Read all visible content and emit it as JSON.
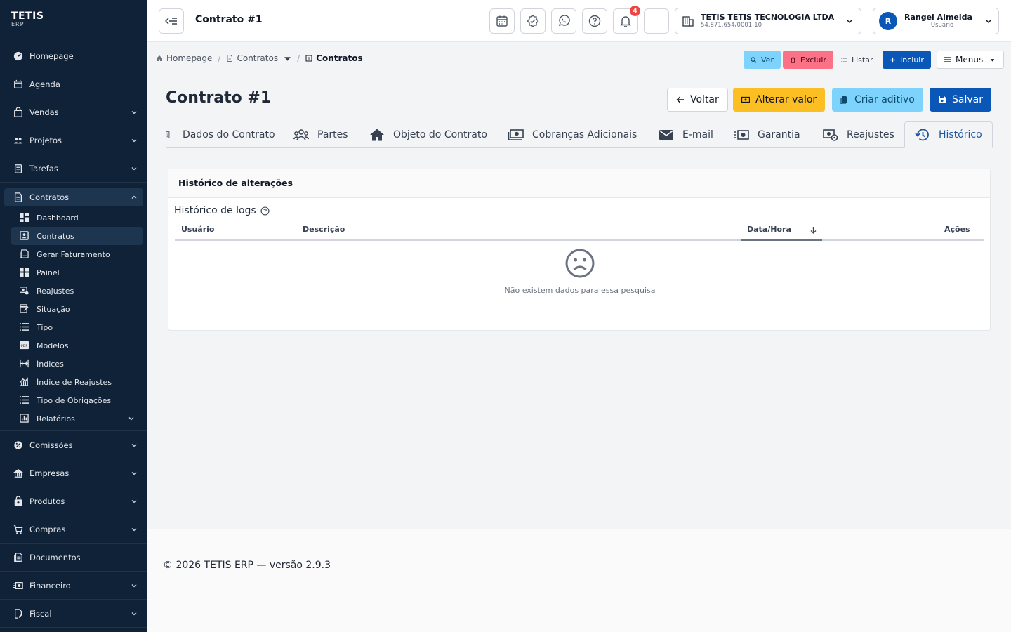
{
  "brand": {
    "name": "TETIS",
    "sub": "ERP"
  },
  "sidebar": {
    "items_top": [
      {
        "label": "Homepage",
        "icon": "dashboard-icon",
        "chev": false
      },
      {
        "label": "Agenda",
        "icon": "calendar-icon",
        "chev": false
      },
      {
        "label": "Vendas",
        "icon": "bag-icon",
        "chev": true
      },
      {
        "label": "Projetos",
        "icon": "people-icon",
        "chev": true
      },
      {
        "label": "Tarefas",
        "icon": "clipboard-icon",
        "chev": true
      }
    ],
    "open_item": {
      "label": "Contratos",
      "icon": "document-icon"
    },
    "sub_items": [
      {
        "label": "Dashboard",
        "icon": "dashboard-grid-icon"
      },
      {
        "label": "Contratos",
        "icon": "contract-icon",
        "active": true
      },
      {
        "label": "Gerar Faturamento",
        "icon": "invoice-icon"
      },
      {
        "label": "Painel",
        "icon": "panel-icon"
      },
      {
        "label": "Reajustes",
        "icon": "adjust-icon"
      },
      {
        "label": "Situação",
        "icon": "status-icon"
      },
      {
        "label": "Tipo",
        "icon": "list-icon"
      },
      {
        "label": "Modelos",
        "icon": "pdf-icon"
      },
      {
        "label": "Índices",
        "icon": "index-icon"
      },
      {
        "label": "Índice de Reajustes",
        "icon": "chart-icon"
      },
      {
        "label": "Tipo de Obrigações",
        "icon": "list-icon"
      },
      {
        "label": "Relatórios",
        "icon": "report-icon",
        "chev": true
      }
    ],
    "items_bottom": [
      {
        "label": "Comissões",
        "icon": "commission-icon",
        "chev": true
      },
      {
        "label": "Empresas",
        "icon": "building-icon",
        "chev": true
      },
      {
        "label": "Produtos",
        "icon": "box-icon",
        "chev": true
      },
      {
        "label": "Compras",
        "icon": "cart-icon",
        "chev": true
      },
      {
        "label": "Documentos",
        "icon": "documents-icon",
        "chev": false
      },
      {
        "label": "Financeiro",
        "icon": "money-icon",
        "chev": true
      },
      {
        "label": "Fiscal",
        "icon": "fiscal-icon",
        "chev": true
      }
    ]
  },
  "topbar": {
    "title": "Contrato #1",
    "notification_count": "4",
    "company_name": "TETIS TETIS TECNOLOGIA LTDA",
    "company_cnpj": "54.871.654/0001-10",
    "user_initial": "R",
    "user_name": "Rangel Almeida",
    "user_role": "Usuário"
  },
  "breadcrumb": {
    "home": "Homepage",
    "parent": "Contratos",
    "current": "Contratos"
  },
  "actions": {
    "ver": "Ver",
    "excluir": "Excluir",
    "listar": "Listar",
    "incluir": "Incluir",
    "menus": "Menus"
  },
  "page": {
    "title": "Contrato #1",
    "btn_voltar": "Voltar",
    "btn_alterar": "Alterar valor",
    "btn_aditivo": "Criar aditivo",
    "btn_salvar": "Salvar"
  },
  "tabs": [
    "Dados do Contrato",
    "Partes",
    "Objeto do Contrato",
    "Cobranças Adicionais",
    "E-mail",
    "Garantia",
    "Reajustes",
    "Histórico"
  ],
  "card": {
    "title": "Histórico de alterações",
    "logs_title": "Histórico de logs",
    "columns": {
      "usuario": "Usuário",
      "descricao": "Descrição",
      "data": "Data/Hora",
      "acoes": "Ações"
    },
    "empty": "Não existem dados para essa pesquisa"
  },
  "footer": "© 2026 TETIS ERP — versão 2.9.3",
  "colors": {
    "sidebar": "#0f2238",
    "primary": "#0b57b8",
    "warning": "#fbbf24",
    "info": "#7dd3fc",
    "danger": "#fb7185"
  }
}
